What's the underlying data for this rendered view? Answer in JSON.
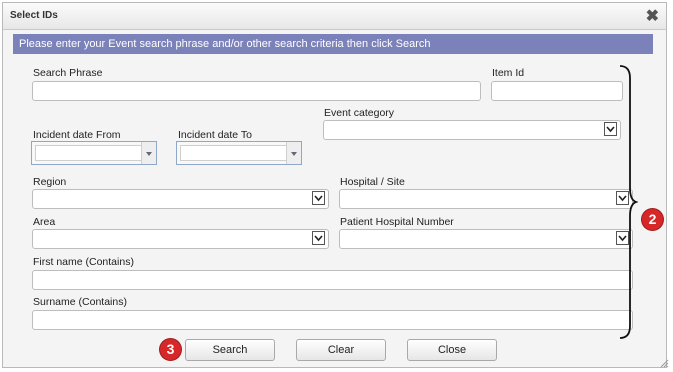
{
  "dialog": {
    "title": "Select IDs",
    "close_glyph": "✖",
    "instruction": "Please enter your Event search phrase and/or other search criteria then click Search"
  },
  "fields": {
    "search_phrase": {
      "label": "Search Phrase",
      "value": ""
    },
    "item_id": {
      "label": "Item Id",
      "value": ""
    },
    "event_category": {
      "label": "Event category",
      "value": ""
    },
    "incident_date_from": {
      "label": "Incident date From",
      "value": ""
    },
    "incident_date_to": {
      "label": "Incident date To",
      "value": ""
    },
    "region": {
      "label": "Region",
      "value": ""
    },
    "hospital_site": {
      "label": "Hospital / Site",
      "value": ""
    },
    "area": {
      "label": "Area",
      "value": ""
    },
    "patient_hospital_number": {
      "label": "Patient Hospital Number",
      "value": ""
    },
    "first_name": {
      "label": "First name (Contains)",
      "value": ""
    },
    "surname": {
      "label": "Surname (Contains)",
      "value": ""
    }
  },
  "buttons": {
    "search": "Search",
    "clear": "Clear",
    "close": "Close"
  },
  "annotations": {
    "badge_fields": "2",
    "badge_search": "3"
  },
  "colors": {
    "banner": "#7b82b9",
    "badge": "#d62828"
  },
  "icons": [
    "close-icon",
    "chevron-down-icon",
    "calendar-dropdown-icon",
    "resize-grip-icon"
  ]
}
